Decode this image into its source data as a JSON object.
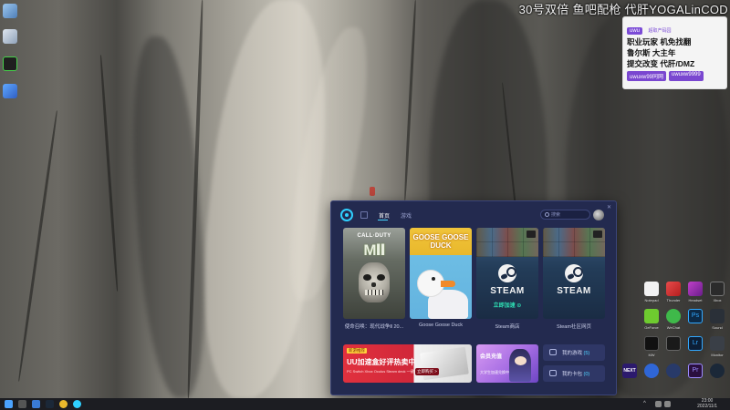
{
  "overlay": {
    "stream_line": "30号双倍 鱼吧配枪 代肝YOGALinCOD",
    "promo_tag": "uwu",
    "promo_sub": "超取产码园",
    "promo_rows": [
      "职业玩家 机免找翻",
      "鲁尔斯 大主年",
      "提交改变 代肝/DMZ"
    ],
    "promo_foot": [
      "uwuxw99同网",
      "uwuxw9999"
    ]
  },
  "uu_window": {
    "tabs": [
      {
        "label": "首页",
        "active": true
      },
      {
        "label": "游戏",
        "active": false
      }
    ],
    "search_placeholder": "搜索",
    "close_label": "✕",
    "games": [
      {
        "title": "使命召唤：现代战争Ⅱ 20...",
        "art_top": "CALL·DUTY",
        "art_main": "MⅡ"
      },
      {
        "title": "Goose Goose Duck",
        "art_main": "GOOSE GOOSE DUCK"
      },
      {
        "title": "Steam商店",
        "art_main": "STEAM",
        "boost_label": "立即加速 ⊙"
      },
      {
        "title": "Steam社区网页",
        "art_main": "STEAM"
      }
    ],
    "banner_uu": {
      "tag": "新游推荐",
      "main": "UU加速盒好评热卖中",
      "sub": "PC Switch Xbox Oculus Steam deck 一键加速",
      "button": "立即购买 >"
    },
    "banner_vip": {
      "main": "会员充值",
      "sub": "大学生加速兑换中 >"
    },
    "side_buttons": [
      {
        "label": "我的游戏",
        "count": "(5)"
      },
      {
        "label": "我的卡包",
        "count": "(0)"
      }
    ]
  },
  "desktop_right_labels": [
    "Notepad",
    "Thunder",
    "Headset",
    "Xbox",
    "GeForce",
    "WeChat",
    "Ps",
    "Sound",
    "Netflix",
    "MW",
    "Lr",
    "Monitor",
    "NEXT",
    "Settings",
    "UU",
    "Pr",
    "Steam"
  ],
  "taskbar": {
    "time": "23:00",
    "date": "2022/11/1"
  }
}
